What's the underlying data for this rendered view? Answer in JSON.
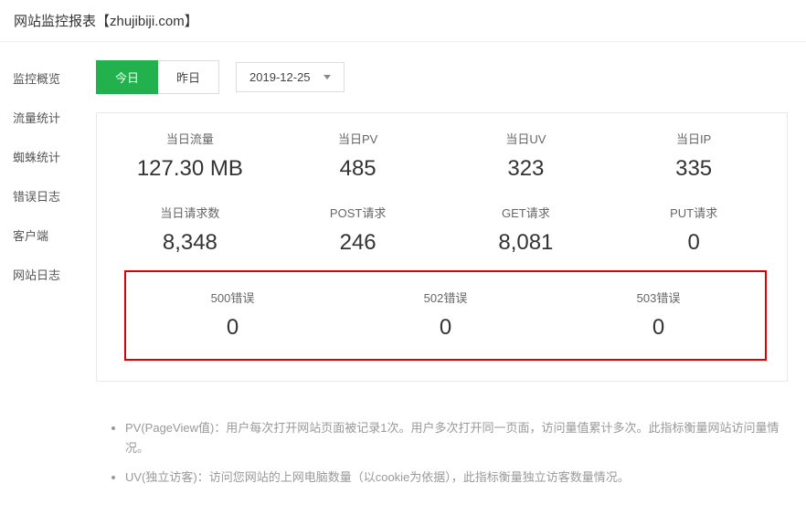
{
  "page_title": "网站监控报表【zhujibiji.com】",
  "sidebar": {
    "items": [
      {
        "label": "监控概览"
      },
      {
        "label": "流量统计"
      },
      {
        "label": "蜘蛛统计"
      },
      {
        "label": "错误日志"
      },
      {
        "label": "客户端"
      },
      {
        "label": "网站日志"
      }
    ]
  },
  "date_tabs": {
    "today": "今日",
    "yesterday": "昨日",
    "picker_value": "2019-12-25"
  },
  "stats": {
    "row1": [
      {
        "label": "当日流量",
        "value": "127.30 MB"
      },
      {
        "label": "当日PV",
        "value": "485"
      },
      {
        "label": "当日UV",
        "value": "323"
      },
      {
        "label": "当日IP",
        "value": "335"
      }
    ],
    "row2": [
      {
        "label": "当日请求数",
        "value": "8,348"
      },
      {
        "label": "POST请求",
        "value": "246"
      },
      {
        "label": "GET请求",
        "value": "8,081"
      },
      {
        "label": "PUT请求",
        "value": "0"
      }
    ],
    "errors": [
      {
        "label": "500错误",
        "value": "0"
      },
      {
        "label": "502错误",
        "value": "0"
      },
      {
        "label": "503错误",
        "value": "0"
      }
    ]
  },
  "notes": {
    "pv": "PV(PageView值)：用户每次打开网站页面被记录1次。用户多次打开同一页面，访问量值累计多次。此指标衡量网站访问量情况。",
    "uv": "UV(独立访客)：访问您网站的上网电脑数量（以cookie为依据），此指标衡量独立访客数量情况。"
  }
}
